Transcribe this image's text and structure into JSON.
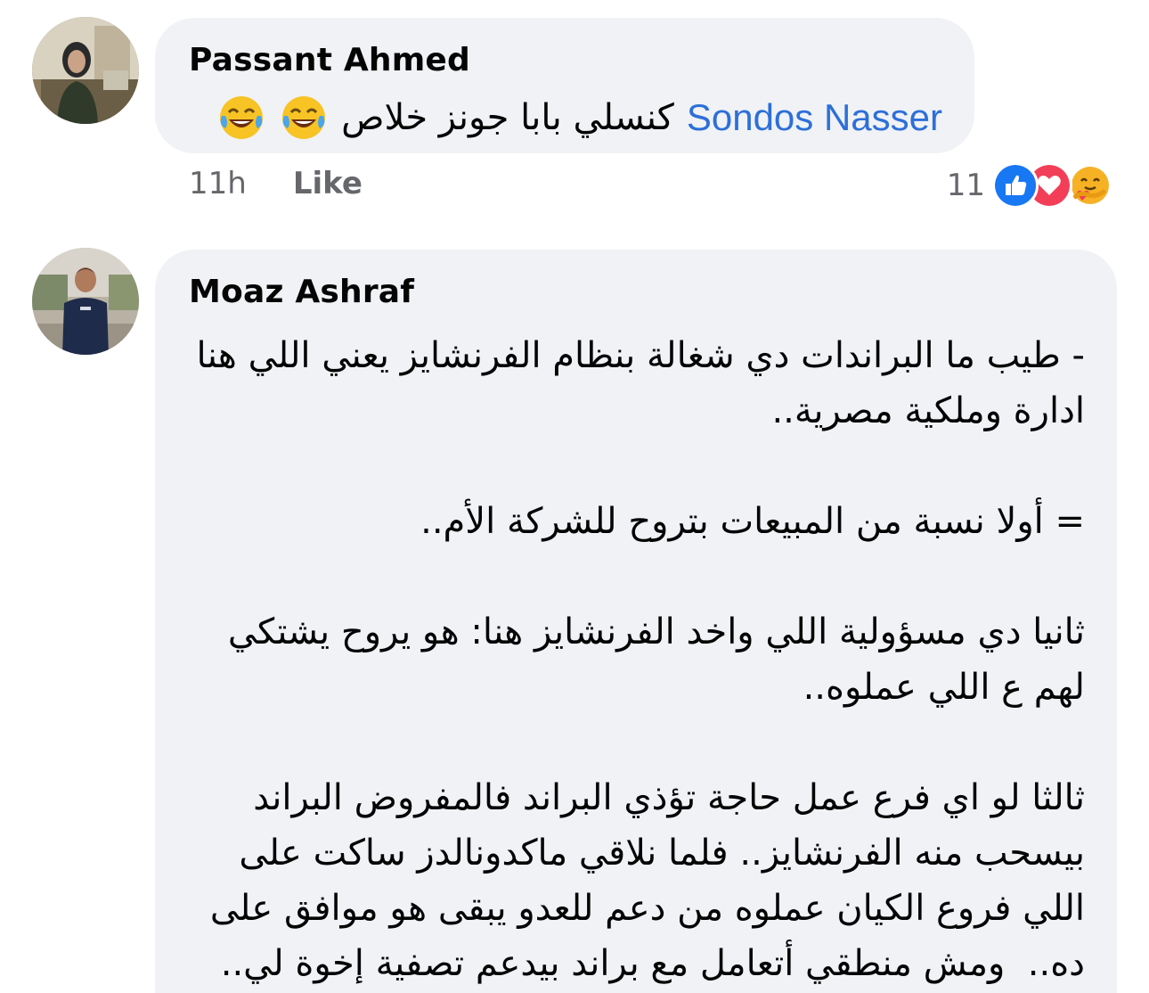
{
  "comments": [
    {
      "author": "Passant Ahmed",
      "mention": "Sondos Nasser",
      "text": "كنسلي بابا جونز خلاص",
      "emojis": [
        "tears-of-joy-icon",
        "tears-of-joy-icon"
      ],
      "time": "11h",
      "like_label": "Like",
      "reaction_count": "11",
      "reactions": [
        "like-icon",
        "love-icon",
        "care-icon"
      ]
    },
    {
      "author": "Moaz Ashraf",
      "paragraphs": [
        "- طيب ما البراندات دي شغالة بنظام الفرنشايز يعني اللي هنا ادارة وملكية مصرية..",
        "= أولا نسبة من المبيعات بتروح للشركة الأم..",
        "ثانيا دي مسؤولية اللي واخد الفرنشايز هنا: هو يروح يشتكي لهم ع اللي عملوه..",
        "ثالثا لو اي فرع عمل حاجة تؤذي البراند فالمفروض البراند بيسحب منه الفرنشايز.. فلما نلاقي ماكدونالدز ساكت على اللي فروع الكيان عملوه من دعم للعدو يبقى هو موافق على ده..  ومش منطقي أتعامل مع براند بيدعم تصفية إخوة لي.."
      ]
    }
  ],
  "colors": {
    "bubble": "#f0f2f5",
    "mention": "#2d6fd8",
    "meta_text": "#65676b",
    "like_blue": "#1877f2",
    "love_red": "#f33e58",
    "care_yellow": "#f7b125"
  }
}
